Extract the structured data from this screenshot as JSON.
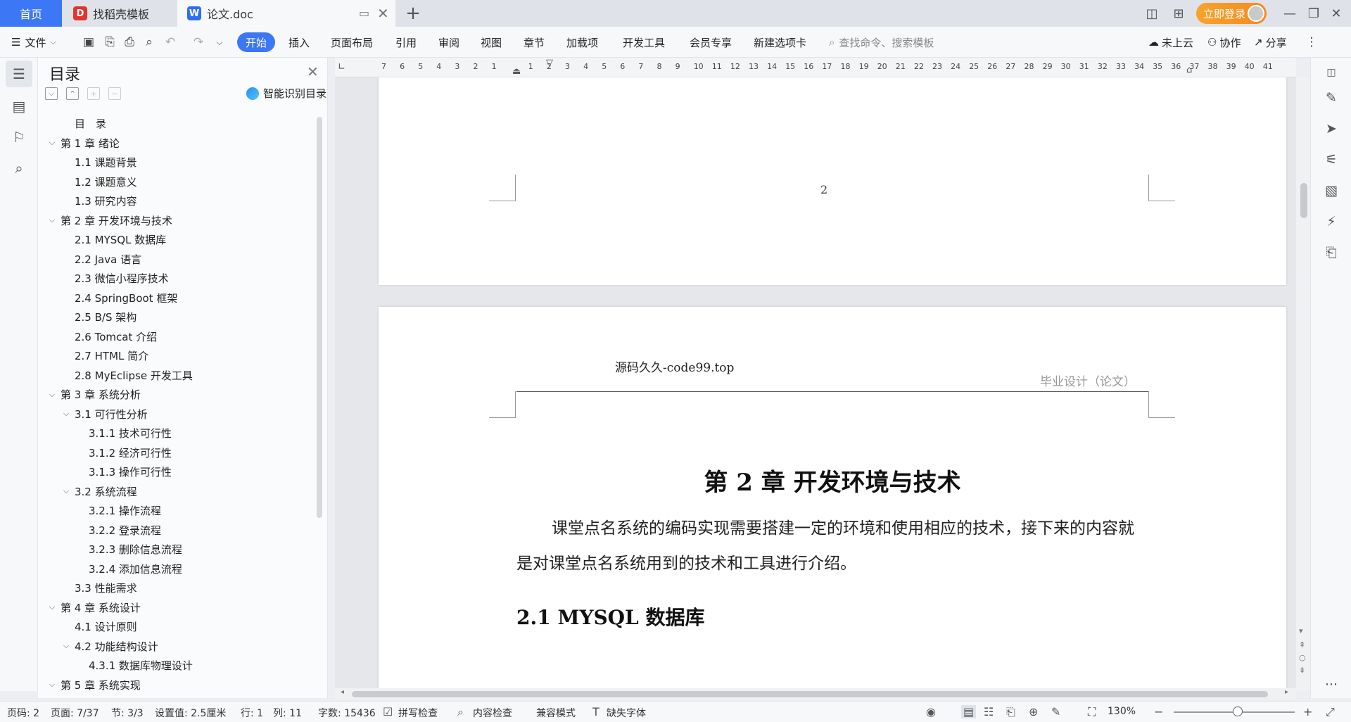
{
  "tabs": {
    "home": "首页",
    "daoke": "找稻壳模板",
    "doc": "论文.doc",
    "daoke_logo": "D",
    "doc_logo": "W"
  },
  "topbar": {
    "login": "立即登录"
  },
  "ribbon": {
    "file": "文件",
    "start": "开始",
    "insert": "插入",
    "layout": "页面布局",
    "reference": "引用",
    "review": "审阅",
    "view": "视图",
    "chapter": "章节",
    "addons": "加载项",
    "devtools": "开发工具",
    "member": "会员专享",
    "newtab": "新建选项卡",
    "search_placeholder": "查找命令、搜索模板",
    "cloud": "未上云",
    "collab": "协作",
    "share": "分享"
  },
  "toc": {
    "title": "目录",
    "smart": "智能识别目录",
    "items": [
      {
        "text": "目　录",
        "level": 1,
        "chev": ""
      },
      {
        "text": "第 1 章  绪论",
        "level": 0,
        "chev": "⌵"
      },
      {
        "text": "1.1  课题背景",
        "level": 1,
        "chev": ""
      },
      {
        "text": "1.2  课题意义",
        "level": 1,
        "chev": ""
      },
      {
        "text": "1.3  研究内容",
        "level": 1,
        "chev": ""
      },
      {
        "text": "第 2 章  开发环境与技术",
        "level": 0,
        "chev": "⌵"
      },
      {
        "text": "2.1 MYSQL 数据库",
        "level": 1,
        "chev": ""
      },
      {
        "text": "2.2 Java 语言",
        "level": 1,
        "chev": ""
      },
      {
        "text": "2.3  微信小程序技术",
        "level": 1,
        "chev": ""
      },
      {
        "text": "2.4 SpringBoot 框架",
        "level": 1,
        "chev": ""
      },
      {
        "text": "2.5 B/S 架构",
        "level": 1,
        "chev": ""
      },
      {
        "text": "2.6 Tomcat  介绍",
        "level": 1,
        "chev": ""
      },
      {
        "text": "2.7 HTML 简介",
        "level": 1,
        "chev": ""
      },
      {
        "text": "2.8 MyEclipse 开发工具",
        "level": 1,
        "chev": ""
      },
      {
        "text": "第 3 章  系统分析",
        "level": 0,
        "chev": "⌵"
      },
      {
        "text": "3.1  可行性分析",
        "level": 1,
        "chev": "⌵"
      },
      {
        "text": "3.1.1  技术可行性",
        "level": 2,
        "chev": ""
      },
      {
        "text": "3.1.2  经济可行性",
        "level": 2,
        "chev": ""
      },
      {
        "text": "3.1.3  操作可行性",
        "level": 2,
        "chev": ""
      },
      {
        "text": "3.2  系统流程",
        "level": 1,
        "chev": "⌵"
      },
      {
        "text": "3.2.1  操作流程",
        "level": 2,
        "chev": ""
      },
      {
        "text": "3.2.2  登录流程",
        "level": 2,
        "chev": ""
      },
      {
        "text": "3.2.3  删除信息流程",
        "level": 2,
        "chev": ""
      },
      {
        "text": "3.2.4  添加信息流程",
        "level": 2,
        "chev": ""
      },
      {
        "text": "3.3  性能需求",
        "level": 1,
        "chev": ""
      },
      {
        "text": "第 4 章  系统设计",
        "level": 0,
        "chev": "⌵"
      },
      {
        "text": "4.1  设计原则",
        "level": 1,
        "chev": ""
      },
      {
        "text": "4.2  功能结构设计",
        "level": 1,
        "chev": "⌵"
      },
      {
        "text": "4.3.1  数据库物理设计",
        "level": 2,
        "chev": ""
      },
      {
        "text": "第 5 章  系统实现",
        "level": 0,
        "chev": "⌵"
      }
    ]
  },
  "ruler": {
    "numbers": [
      "7",
      "6",
      "5",
      "4",
      "3",
      "2",
      "1",
      "",
      "1",
      "2",
      "3",
      "4",
      "5",
      "6",
      "7",
      "8",
      "9",
      "10",
      "11",
      "12",
      "13",
      "14",
      "15",
      "16",
      "17",
      "18",
      "19",
      "20",
      "21",
      "22",
      "23",
      "24",
      "25",
      "26",
      "27",
      "28",
      "29",
      "30",
      "31",
      "32",
      "33",
      "34",
      "35",
      "36",
      "37",
      "38",
      "39",
      "40",
      "41"
    ]
  },
  "document": {
    "page_number": "2",
    "header_left": "源码久久-code99.top",
    "header_right": "毕业设计（论文）",
    "chapter_title": "第 2 章  开发环境与技术",
    "paragraph": "课堂点名系统的编码实现需要搭建一定的环境和使用相应的技术，接下来的内容就是对课堂点名系统用到的技术和工具进行介绍。",
    "section_title": "2.1 MYSQL 数据库"
  },
  "status": {
    "page_code": "页码: 2",
    "page": "页面: 7/37",
    "section": "节: 3/3",
    "setting": "设置值: 2.5厘米",
    "row": "行: 1",
    "col": "列: 11",
    "words": "字数: 15436",
    "spell": "拼写检查",
    "content_check": "内容检查",
    "compat": "兼容模式",
    "missing_font": "缺失字体",
    "zoom": "130%"
  }
}
